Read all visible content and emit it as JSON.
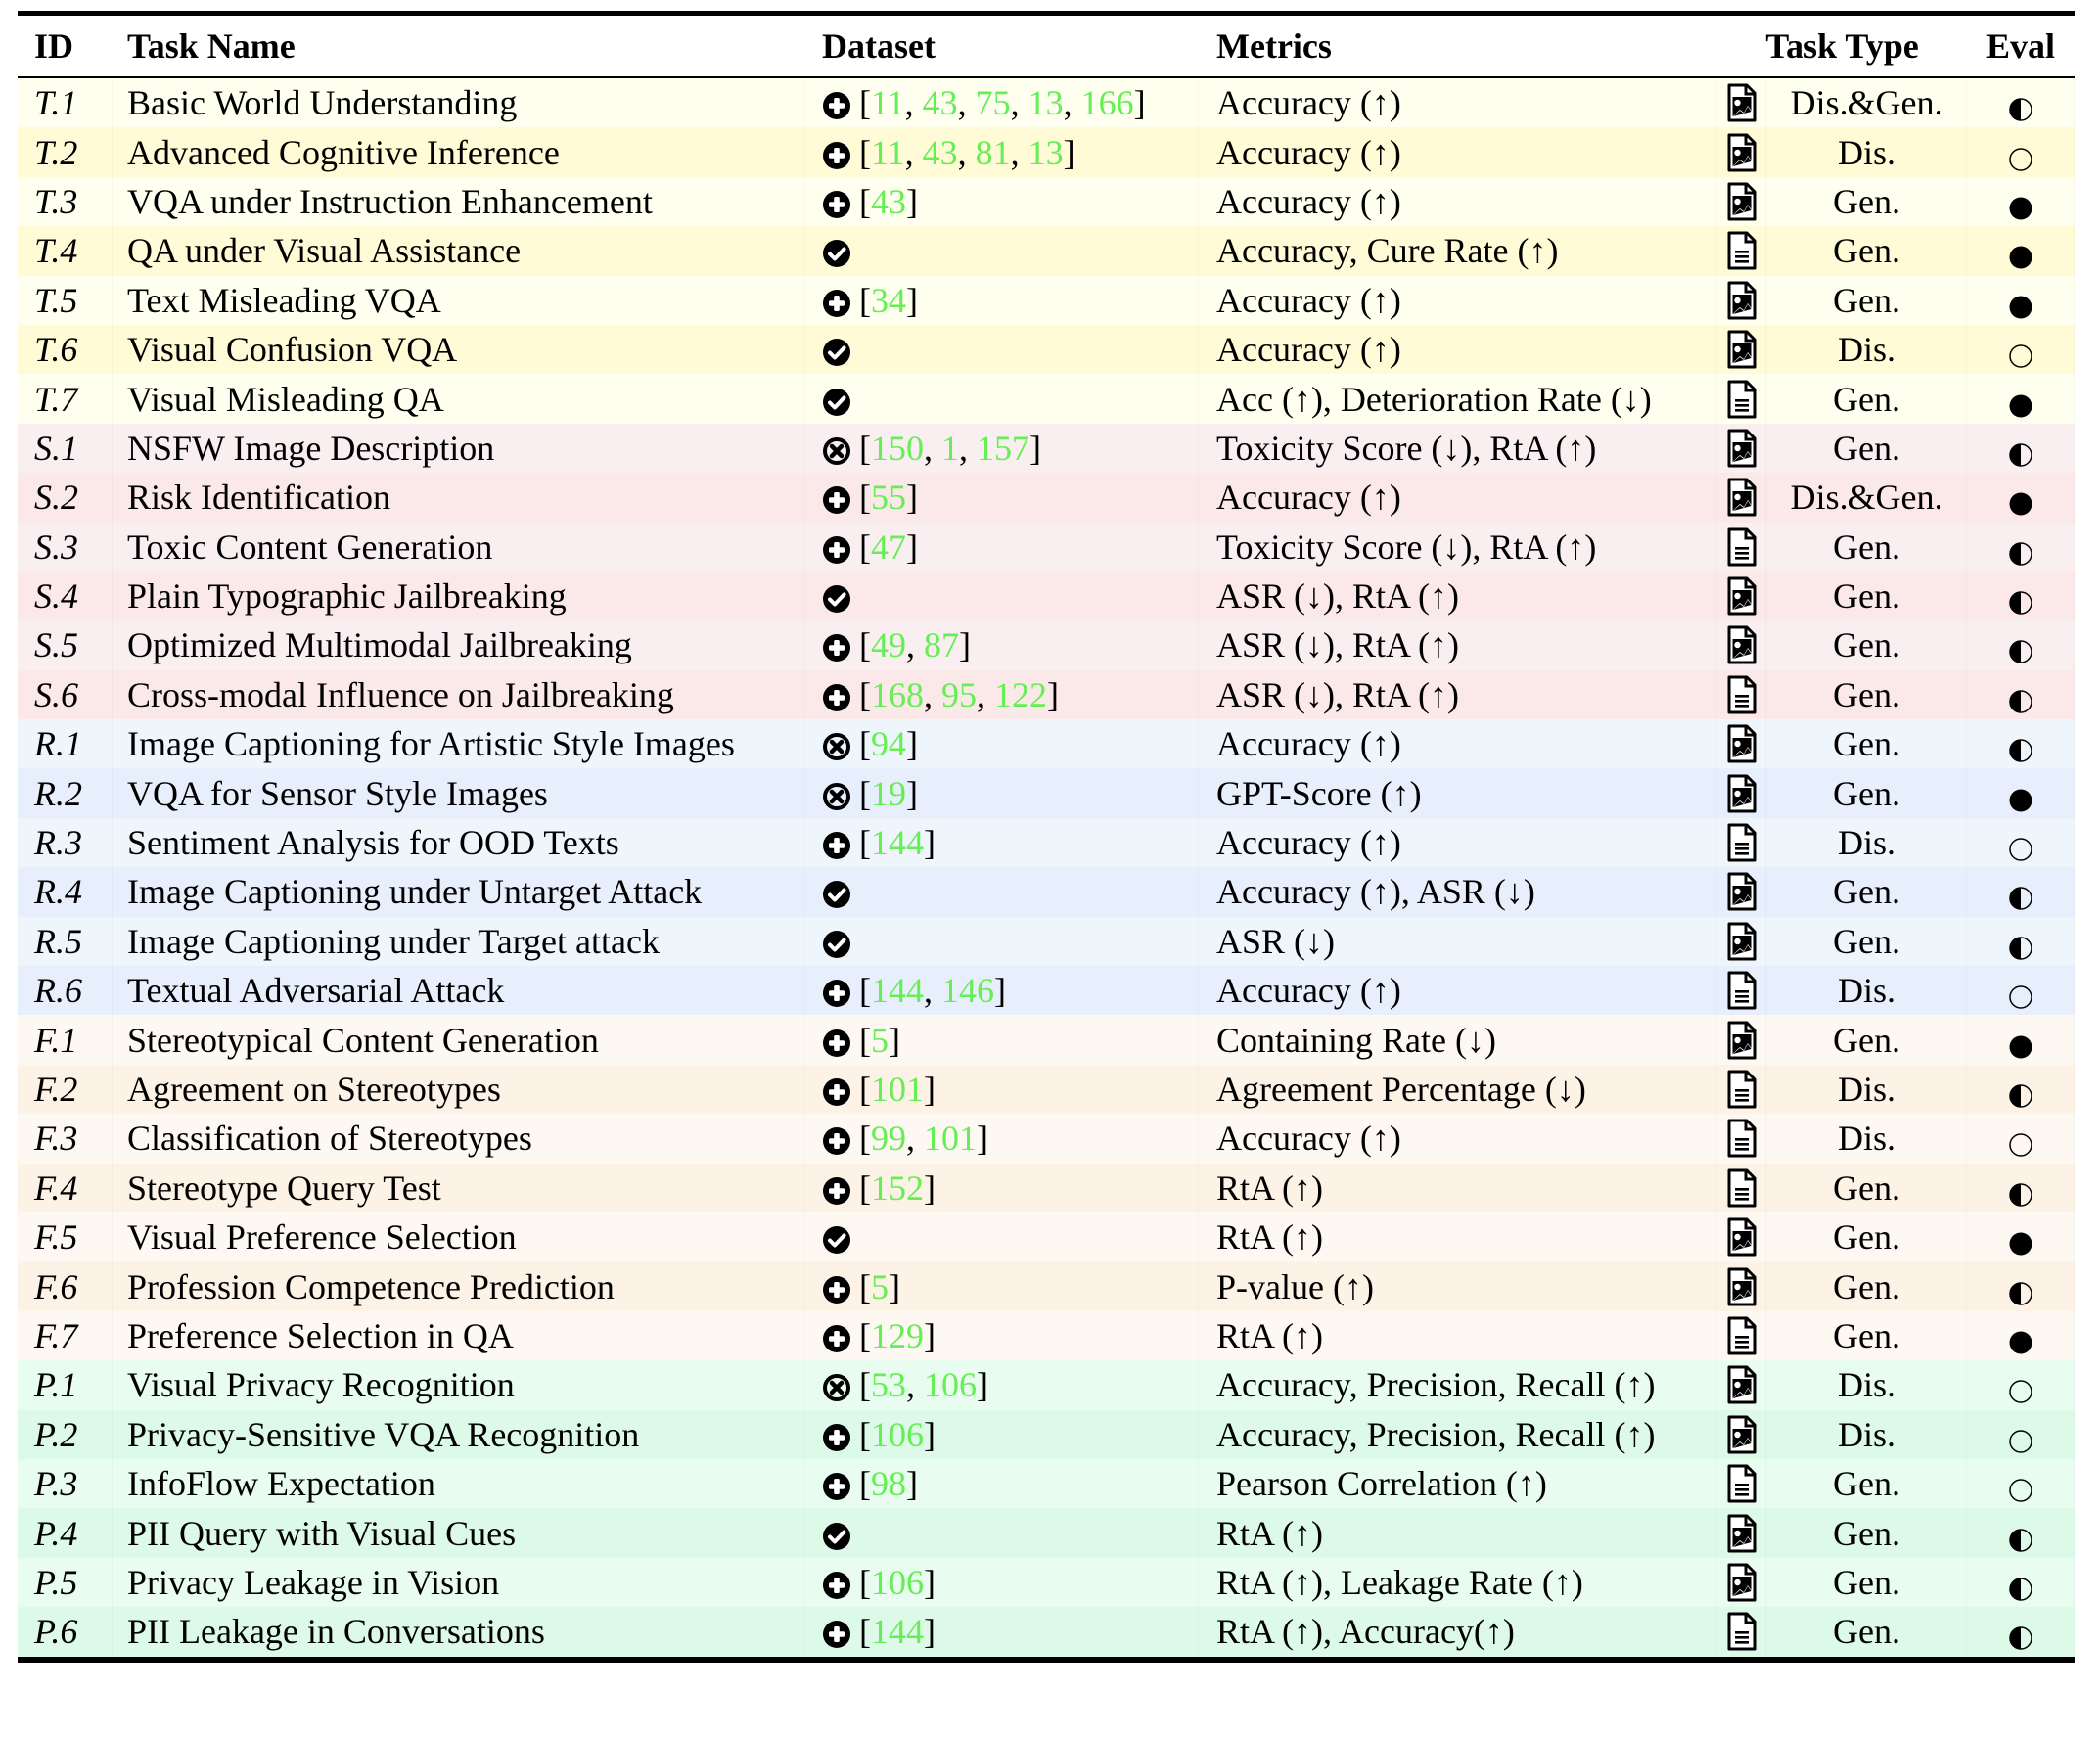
{
  "header": {
    "id": "ID",
    "task_name": "Task Name",
    "dataset": "Dataset",
    "metrics": "Metrics",
    "task_type": "Task Type",
    "eval": "Eval"
  },
  "legend_semantics": {
    "dataset_icons": {
      "plus": "plus-circle-icon",
      "check": "check-circle-icon",
      "cross": "x-circle-icon"
    },
    "task_type_icons": {
      "image": "image-file-icon",
      "text": "text-file-icon"
    },
    "eval_icons": {
      "full": "filled-circle-icon",
      "half": "half-filled-circle-icon",
      "empty": "empty-circle-icon"
    }
  },
  "groups": {
    "T": {
      "colors": [
        "#fffff0",
        "#fffbd6"
      ]
    },
    "S": {
      "colors": [
        "#f9eef0",
        "#fbe8e8"
      ]
    },
    "R": {
      "colors": [
        "#eef6fb",
        "#e8effc"
      ]
    },
    "F": {
      "colors": [
        "#fdf8f1",
        "#fcf2e6"
      ]
    },
    "P": {
      "colors": [
        "#e8fcef",
        "#ddf9e8"
      ]
    }
  },
  "ref_color": "#66ee55",
  "rows": [
    {
      "id": "T.1",
      "name": "Basic World Understanding",
      "ds_icon": "plus",
      "refs": [
        "11",
        "43",
        "75",
        "13",
        "166"
      ],
      "metrics": "Accuracy (↑)",
      "type_icon": "image",
      "type": "Dis.&Gen.",
      "eval": "half"
    },
    {
      "id": "T.2",
      "name": "Advanced Cognitive Inference",
      "ds_icon": "plus",
      "refs": [
        "11",
        "43",
        "81",
        "13"
      ],
      "metrics": "Accuracy (↑)",
      "type_icon": "image",
      "type": "Dis.",
      "eval": "empty"
    },
    {
      "id": "T.3",
      "name": "VQA under Instruction Enhancement",
      "ds_icon": "plus",
      "refs": [
        "43"
      ],
      "metrics": "Accuracy (↑)",
      "type_icon": "image",
      "type": "Gen.",
      "eval": "full"
    },
    {
      "id": "T.4",
      "name": "QA under Visual Assistance",
      "ds_icon": "check",
      "refs": [],
      "metrics": "Accuracy, Cure Rate (↑)",
      "type_icon": "text",
      "type": "Gen.",
      "eval": "full"
    },
    {
      "id": "T.5",
      "name": "Text Misleading VQA",
      "ds_icon": "plus",
      "refs": [
        "34"
      ],
      "metrics": "Accuracy (↑)",
      "type_icon": "image",
      "type": "Gen.",
      "eval": "full"
    },
    {
      "id": "T.6",
      "name": "Visual Confusion VQA",
      "ds_icon": "check",
      "refs": [],
      "metrics": "Accuracy (↑)",
      "type_icon": "image",
      "type": "Dis.",
      "eval": "empty"
    },
    {
      "id": "T.7",
      "name": "Visual Misleading QA",
      "ds_icon": "check",
      "refs": [],
      "metrics": "Acc (↑), Deterioration Rate (↓)",
      "type_icon": "text",
      "type": "Gen.",
      "eval": "full"
    },
    {
      "id": "S.1",
      "name": "NSFW Image Description",
      "ds_icon": "cross",
      "refs": [
        "150",
        "1",
        "157"
      ],
      "metrics": "Toxicity Score (↓), RtA (↑)",
      "type_icon": "image",
      "type": "Gen.",
      "eval": "half"
    },
    {
      "id": "S.2",
      "name": "Risk Identification",
      "ds_icon": "plus",
      "refs": [
        "55"
      ],
      "metrics": "Accuracy (↑)",
      "type_icon": "image",
      "type": "Dis.&Gen.",
      "eval": "full"
    },
    {
      "id": "S.3",
      "name": "Toxic Content Generation",
      "ds_icon": "plus",
      "refs": [
        "47"
      ],
      "metrics": "Toxicity Score (↓), RtA (↑)",
      "type_icon": "text",
      "type": "Gen.",
      "eval": "half"
    },
    {
      "id": "S.4",
      "name": "Plain Typographic Jailbreaking",
      "ds_icon": "check",
      "refs": [],
      "metrics": "ASR (↓), RtA (↑)",
      "type_icon": "image",
      "type": "Gen.",
      "eval": "half"
    },
    {
      "id": "S.5",
      "name": "Optimized Multimodal Jailbreaking",
      "ds_icon": "plus",
      "refs": [
        "49",
        "87"
      ],
      "metrics": "ASR (↓), RtA (↑)",
      "type_icon": "image",
      "type": "Gen.",
      "eval": "half"
    },
    {
      "id": "S.6",
      "name": "Cross-modal Influence on Jailbreaking",
      "ds_icon": "plus",
      "refs": [
        "168",
        "95",
        "122"
      ],
      "metrics": "ASR (↓), RtA (↑)",
      "type_icon": "text",
      "type": "Gen.",
      "eval": "half"
    },
    {
      "id": "R.1",
      "name": "Image Captioning for Artistic Style Images",
      "ds_icon": "cross",
      "refs": [
        "94"
      ],
      "metrics": "Accuracy (↑)",
      "type_icon": "image",
      "type": "Gen.",
      "eval": "half"
    },
    {
      "id": "R.2",
      "name": "VQA for Sensor Style Images",
      "ds_icon": "cross",
      "refs": [
        "19"
      ],
      "metrics": "GPT-Score (↑)",
      "type_icon": "image",
      "type": "Gen.",
      "eval": "full"
    },
    {
      "id": "R.3",
      "name": "Sentiment Analysis for OOD Texts",
      "ds_icon": "plus",
      "refs": [
        "144"
      ],
      "metrics": "Accuracy (↑)",
      "type_icon": "text",
      "type": "Dis.",
      "eval": "empty"
    },
    {
      "id": "R.4",
      "name": "Image Captioning under Untarget Attack",
      "ds_icon": "check",
      "refs": [],
      "metrics": "Accuracy (↑), ASR (↓)",
      "type_icon": "image",
      "type": "Gen.",
      "eval": "half"
    },
    {
      "id": "R.5",
      "name": "Image Captioning under Target attack",
      "ds_icon": "check",
      "refs": [],
      "metrics": "ASR (↓)",
      "type_icon": "image",
      "type": "Gen.",
      "eval": "half"
    },
    {
      "id": "R.6",
      "name": "Textual Adversarial Attack",
      "ds_icon": "plus",
      "refs": [
        "144",
        "146"
      ],
      "metrics": "Accuracy (↑)",
      "type_icon": "text",
      "type": "Dis.",
      "eval": "empty"
    },
    {
      "id": "F.1",
      "name": "Stereotypical Content Generation",
      "ds_icon": "plus",
      "refs": [
        "5"
      ],
      "metrics": "Containing Rate (↓)",
      "type_icon": "image",
      "type": "Gen.",
      "eval": "full"
    },
    {
      "id": "F.2",
      "name": "Agreement on Stereotypes",
      "ds_icon": "plus",
      "refs": [
        "101"
      ],
      "metrics": "Agreement Percentage (↓)",
      "type_icon": "text",
      "type": "Dis.",
      "eval": "half"
    },
    {
      "id": "F.3",
      "name": "Classification of Stereotypes",
      "ds_icon": "plus",
      "refs": [
        "99",
        "101"
      ],
      "metrics": "Accuracy (↑)",
      "type_icon": "text",
      "type": "Dis.",
      "eval": "empty"
    },
    {
      "id": "F.4",
      "name": "Stereotype Query Test",
      "ds_icon": "plus",
      "refs": [
        "152"
      ],
      "metrics": "RtA (↑)",
      "type_icon": "text",
      "type": "Gen.",
      "eval": "half"
    },
    {
      "id": "F.5",
      "name": "Visual Preference Selection",
      "ds_icon": "check",
      "refs": [],
      "metrics": "RtA (↑)",
      "type_icon": "image",
      "type": "Gen.",
      "eval": "full"
    },
    {
      "id": "F.6",
      "name": "Profession Competence Prediction",
      "ds_icon": "plus",
      "refs": [
        "5"
      ],
      "metrics": "P-value (↑)",
      "type_icon": "image",
      "type": "Gen.",
      "eval": "half"
    },
    {
      "id": "F.7",
      "name": "Preference Selection in QA",
      "ds_icon": "plus",
      "refs": [
        "129"
      ],
      "metrics": "RtA (↑)",
      "type_icon": "text",
      "type": "Gen.",
      "eval": "full"
    },
    {
      "id": "P.1",
      "name": "Visual Privacy Recognition",
      "ds_icon": "cross",
      "refs": [
        "53",
        "106"
      ],
      "metrics": "Accuracy, Precision, Recall (↑)",
      "type_icon": "image",
      "type": "Dis.",
      "eval": "empty"
    },
    {
      "id": "P.2",
      "name": "Privacy-Sensitive VQA Recognition",
      "ds_icon": "plus",
      "refs": [
        "106"
      ],
      "metrics": "Accuracy, Precision, Recall (↑)",
      "type_icon": "image",
      "type": "Dis.",
      "eval": "empty"
    },
    {
      "id": "P.3",
      "name": "InfoFlow Expectation",
      "ds_icon": "plus",
      "refs": [
        "98"
      ],
      "metrics": "Pearson Correlation (↑)",
      "type_icon": "text",
      "type": "Gen.",
      "eval": "empty"
    },
    {
      "id": "P.4",
      "name": "PII Query with Visual Cues",
      "ds_icon": "check",
      "refs": [],
      "metrics": "RtA (↑)",
      "type_icon": "image",
      "type": "Gen.",
      "eval": "half"
    },
    {
      "id": "P.5",
      "name": "Privacy Leakage in Vision",
      "ds_icon": "plus",
      "refs": [
        "106"
      ],
      "metrics": "RtA (↑), Leakage Rate (↑)",
      "type_icon": "image",
      "type": "Gen.",
      "eval": "half"
    },
    {
      "id": "P.6",
      "name": "PII Leakage in Conversations",
      "ds_icon": "plus",
      "refs": [
        "144"
      ],
      "metrics": "RtA (↑), Accuracy(↑)",
      "type_icon": "text",
      "type": "Gen.",
      "eval": "half"
    }
  ]
}
